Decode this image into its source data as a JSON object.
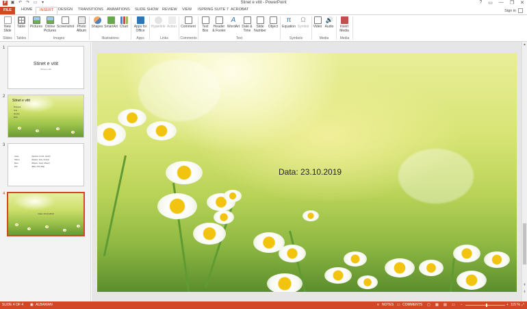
{
  "window": {
    "title": "Stinet e vitit - PowerPoint",
    "help": "?",
    "minimize": "—",
    "restore": "❐",
    "close": "✕"
  },
  "tabs": [
    "FILE",
    "HOME",
    "INSERT",
    "DESIGN",
    "TRANSITIONS",
    "ANIMATIONS",
    "SLIDE SHOW",
    "REVIEW",
    "VIEW",
    "ISPRING SUITE 7",
    "ACROBAT"
  ],
  "active_tab": "INSERT",
  "signin": "Sign in",
  "ribbon": {
    "new_slide": "New\nSlide",
    "table": "Table",
    "pictures": "Pictures",
    "online_pictures": "Online\nPictures",
    "screenshot": "Screenshot",
    "photo_album": "Photo\nAlbum",
    "shapes": "Shapes",
    "smartart": "SmartArt",
    "chart": "Chart",
    "apps_for_office": "Apps for\nOffice",
    "hyperlink": "Hyperlink",
    "action": "Action",
    "comment": "Comment",
    "text_box": "Text\nBox",
    "header_footer": "Header\n& Footer",
    "wordart": "WordArt",
    "date_time": "Date &\nTime",
    "slide_number": "Slide\nNumber",
    "object": "Object",
    "equation": "Equation",
    "symbol": "Symbol",
    "video": "Video",
    "audio": "Audio",
    "insert_media": "Insert\nMedia",
    "groups": {
      "slides": "Slides",
      "tables": "Tables",
      "images": "Images",
      "illustrations": "Illustrations",
      "apps": "Apps",
      "links": "Links",
      "comments": "Comments",
      "text": "Text",
      "symbols": "Symbols",
      "media": "Media",
      "media2": "Media"
    }
  },
  "slides": [
    {
      "number": "1",
      "title": "Stinet e vitit",
      "subtitle": "Stinet e vitit"
    },
    {
      "number": "2",
      "title": "Stinet e vitit",
      "bullets": [
        "Pranvera",
        "Vera",
        "Vjeshta",
        "Dimri"
      ]
    },
    {
      "number": "3",
      "col1": [
        "Janar",
        "Shkurt",
        "Mars",
        "Prill"
      ],
      "col2": [
        "(Qershor, Korrik, Gusht)",
        "(Shtator, Tetor, Nentor)",
        "(Dhjetor, Janar, Shkurt)",
        "(Mars, Prill, Maj)"
      ]
    },
    {
      "number": "4",
      "text": "Data: 23.10.2019"
    }
  ],
  "current_slide": {
    "text": "Data: 23.10.2019"
  },
  "status": {
    "slide_of": "SLIDE 4 OF 4",
    "language": "ALBANIAN",
    "notes": "NOTES",
    "comments": "COMMENTS",
    "zoom": "115 %"
  },
  "colors": {
    "accent": "#d24726",
    "ribbon_bg": "#ffffff",
    "panel_bg": "#f3f3f3",
    "workspace_bg": "#e6e6e6"
  }
}
